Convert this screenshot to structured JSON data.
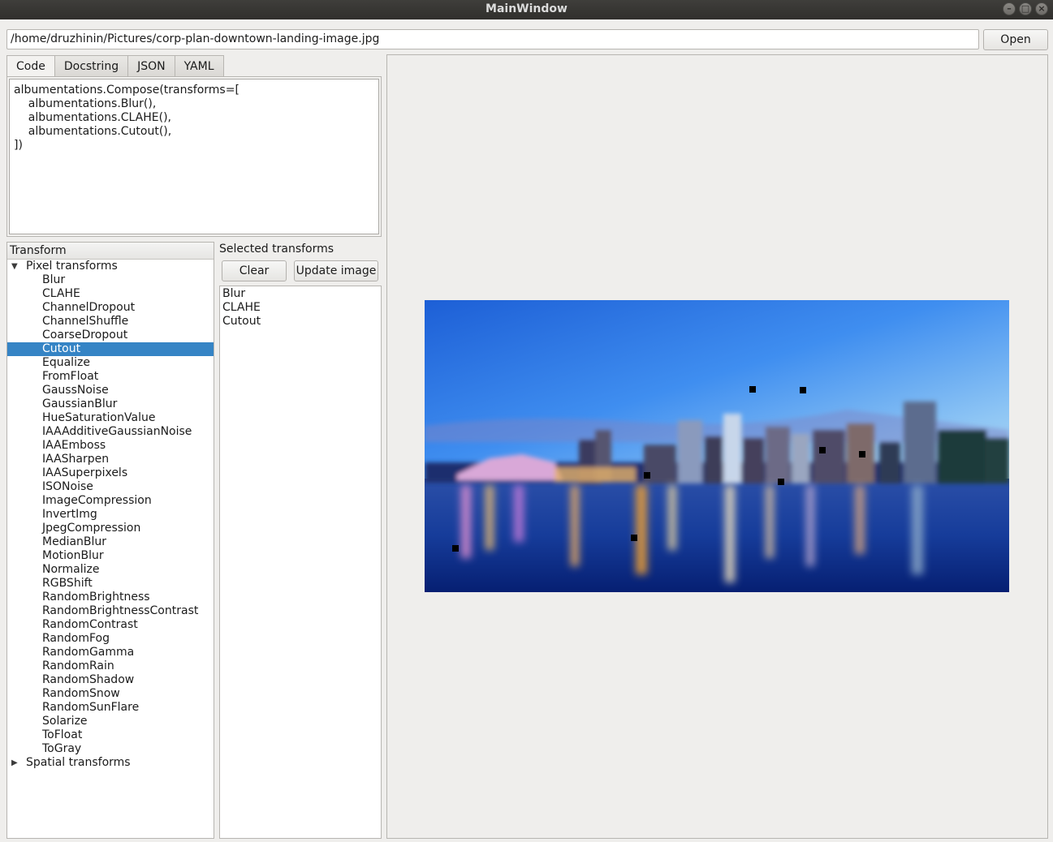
{
  "window": {
    "title": "MainWindow"
  },
  "file": {
    "path": "/home/druzhinin/Pictures/corp-plan-downtown-landing-image.jpg",
    "open_label": "Open"
  },
  "tabs": [
    {
      "label": "Code"
    },
    {
      "label": "Docstring"
    },
    {
      "label": "JSON"
    },
    {
      "label": "YAML"
    }
  ],
  "code": "albumentations.Compose(transforms=[\n    albumentations.Blur(),\n    albumentations.CLAHE(),\n    albumentations.Cutout(),\n])",
  "tree": {
    "header": "Transform",
    "pixel_group": "Pixel transforms",
    "spatial_group": "Spatial transforms",
    "selected": "Cutout",
    "pixel_items": [
      "Blur",
      "CLAHE",
      "ChannelDropout",
      "ChannelShuffle",
      "CoarseDropout",
      "Cutout",
      "Equalize",
      "FromFloat",
      "GaussNoise",
      "GaussianBlur",
      "HueSaturationValue",
      "IAAAdditiveGaussianNoise",
      "IAAEmboss",
      "IAASharpen",
      "IAASuperpixels",
      "ISONoise",
      "ImageCompression",
      "InvertImg",
      "JpegCompression",
      "MedianBlur",
      "MotionBlur",
      "Normalize",
      "RGBShift",
      "RandomBrightness",
      "RandomBrightnessContrast",
      "RandomContrast",
      "RandomFog",
      "RandomGamma",
      "RandomRain",
      "RandomShadow",
      "RandomSnow",
      "RandomSunFlare",
      "Solarize",
      "ToFloat",
      "ToGray"
    ]
  },
  "selected_transforms": {
    "label": "Selected transforms",
    "clear_label": "Clear",
    "update_label": "Update image",
    "items": [
      "Blur",
      "CLAHE",
      "Cutout"
    ]
  }
}
